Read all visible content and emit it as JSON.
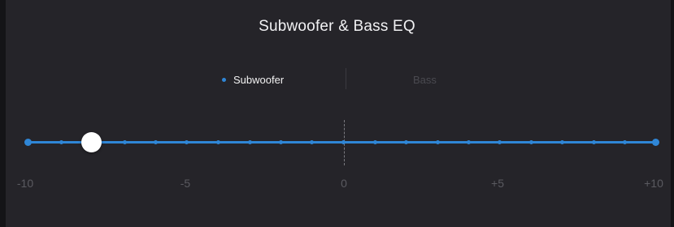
{
  "header": {
    "title": "Subwoofer & Bass EQ"
  },
  "tabs": [
    {
      "label": "Subwoofer",
      "active": true
    },
    {
      "label": "Bass",
      "active": false
    }
  ],
  "slider": {
    "min": -10,
    "max": 10,
    "value": -8,
    "tick_count": 21,
    "scale_labels": [
      "-10",
      "-5",
      "0",
      "+5",
      "+10"
    ]
  },
  "colors": {
    "background": "#252429",
    "accent": "#2f86d6",
    "active_text": "#f2f2f2",
    "inactive_text": "#4a4a50"
  }
}
